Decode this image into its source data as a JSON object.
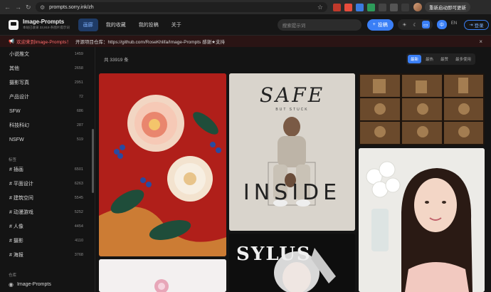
{
  "browser": {
    "url": "prompts.sorry.ink/zh",
    "update_label": "重新启动即可更新"
  },
  "header": {
    "brand_title": "Image-Prompts",
    "brand_subtitle": "本站已收录 33,919 条图片提示词",
    "nav": [
      "画廊",
      "我的收藏",
      "我的投稿",
      "关于"
    ],
    "search_placeholder": "搜索提示词",
    "submit_label": "投稿",
    "lang_zh": "中",
    "lang_en": "EN",
    "login_label": "登录"
  },
  "announcement": {
    "highlight": "欢迎来到Image-Prompts！",
    "text": "开源项目仓库：https://github.com/RoseKhlifa/Image-Prompts 感谢★支持"
  },
  "sidebar": {
    "categories": [
      {
        "label": "小说推文",
        "count": "1459"
      },
      {
        "label": "其他",
        "count": "2658"
      },
      {
        "label": "摄影写真",
        "count": "2951"
      },
      {
        "label": "产品设计",
        "count": "72"
      },
      {
        "label": "SFW",
        "count": "686"
      },
      {
        "label": "科技科幻",
        "count": "287"
      },
      {
        "label": "NSFW",
        "count": "519"
      }
    ],
    "tags_heading": "标签",
    "tags": [
      {
        "label": "# 插画",
        "count": "6501"
      },
      {
        "label": "# 平面设计",
        "count": "6263"
      },
      {
        "label": "# 建筑空间",
        "count": "5545"
      },
      {
        "label": "# 动漫游戏",
        "count": "5252"
      },
      {
        "label": "# 人像",
        "count": "4454"
      },
      {
        "label": "# 摄影",
        "count": "4110"
      },
      {
        "label": "# 海报",
        "count": "3768"
      }
    ],
    "repo_heading": "仓库",
    "repo_item": "Image-Prompts"
  },
  "main": {
    "total": "共 33919 条",
    "sorts": [
      "最新",
      "最热",
      "最赞",
      "最多使用"
    ]
  },
  "cards": {
    "safe_title": "SAFE",
    "safe_sub": "BUT STUCK",
    "inside": "INSIDE",
    "sylus": "SYLUS"
  },
  "colors": {
    "accent": "#3a7ff6",
    "announcement_bg": "#2a1414",
    "background": "#141414"
  }
}
